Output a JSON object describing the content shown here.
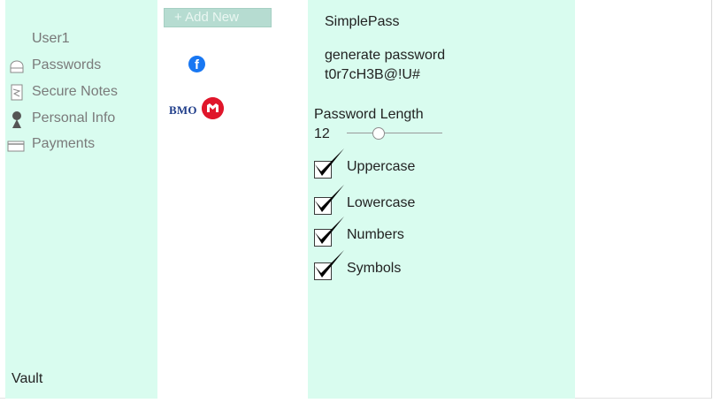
{
  "sidebar": {
    "user": "User1",
    "items": [
      {
        "label": "Passwords",
        "icon": "safe-icon"
      },
      {
        "label": "Secure Notes",
        "icon": "note-icon"
      },
      {
        "label": "Personal Info",
        "icon": "person-icon"
      },
      {
        "label": "Payments",
        "icon": "card-icon"
      }
    ],
    "footer": "Vault"
  },
  "list": {
    "add_new": "+ Add New",
    "entries": [
      {
        "name": "Facebook",
        "icon": "facebook-icon",
        "color": "#1877f2"
      },
      {
        "name": "BMO",
        "logo_text": "BMO",
        "icon": "bmo-logo",
        "color": "#e0162b"
      }
    ]
  },
  "panel": {
    "app_name": "SimplePass",
    "generate_label": "generate password",
    "generated_password": "t0r7cH3B@!U#",
    "length_label": "Password Length",
    "length_value": "12",
    "length_fraction": 0.3,
    "options": [
      {
        "label": "Uppercase",
        "checked": true
      },
      {
        "label": "Lowercase",
        "checked": true
      },
      {
        "label": "Numbers",
        "checked": true
      },
      {
        "label": "Symbols",
        "checked": true
      }
    ]
  },
  "colors": {
    "panel_bg": "#d9fcef",
    "add_button_bg": "#b6dcd1"
  }
}
